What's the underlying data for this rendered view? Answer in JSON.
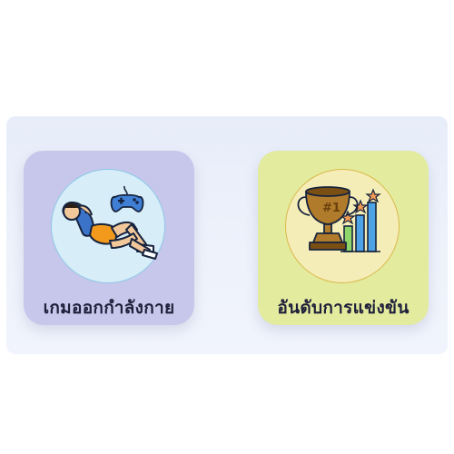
{
  "menu": {
    "items": [
      {
        "label": "เกมออกกำลังกาย",
        "icon": "exercise-situp-gamepad-icon",
        "color": "#c6c7ea"
      },
      {
        "label": "อันดับการแข่งขัน",
        "icon": "trophy-leaderboard-icon",
        "color": "#e3eb9e"
      }
    ]
  }
}
